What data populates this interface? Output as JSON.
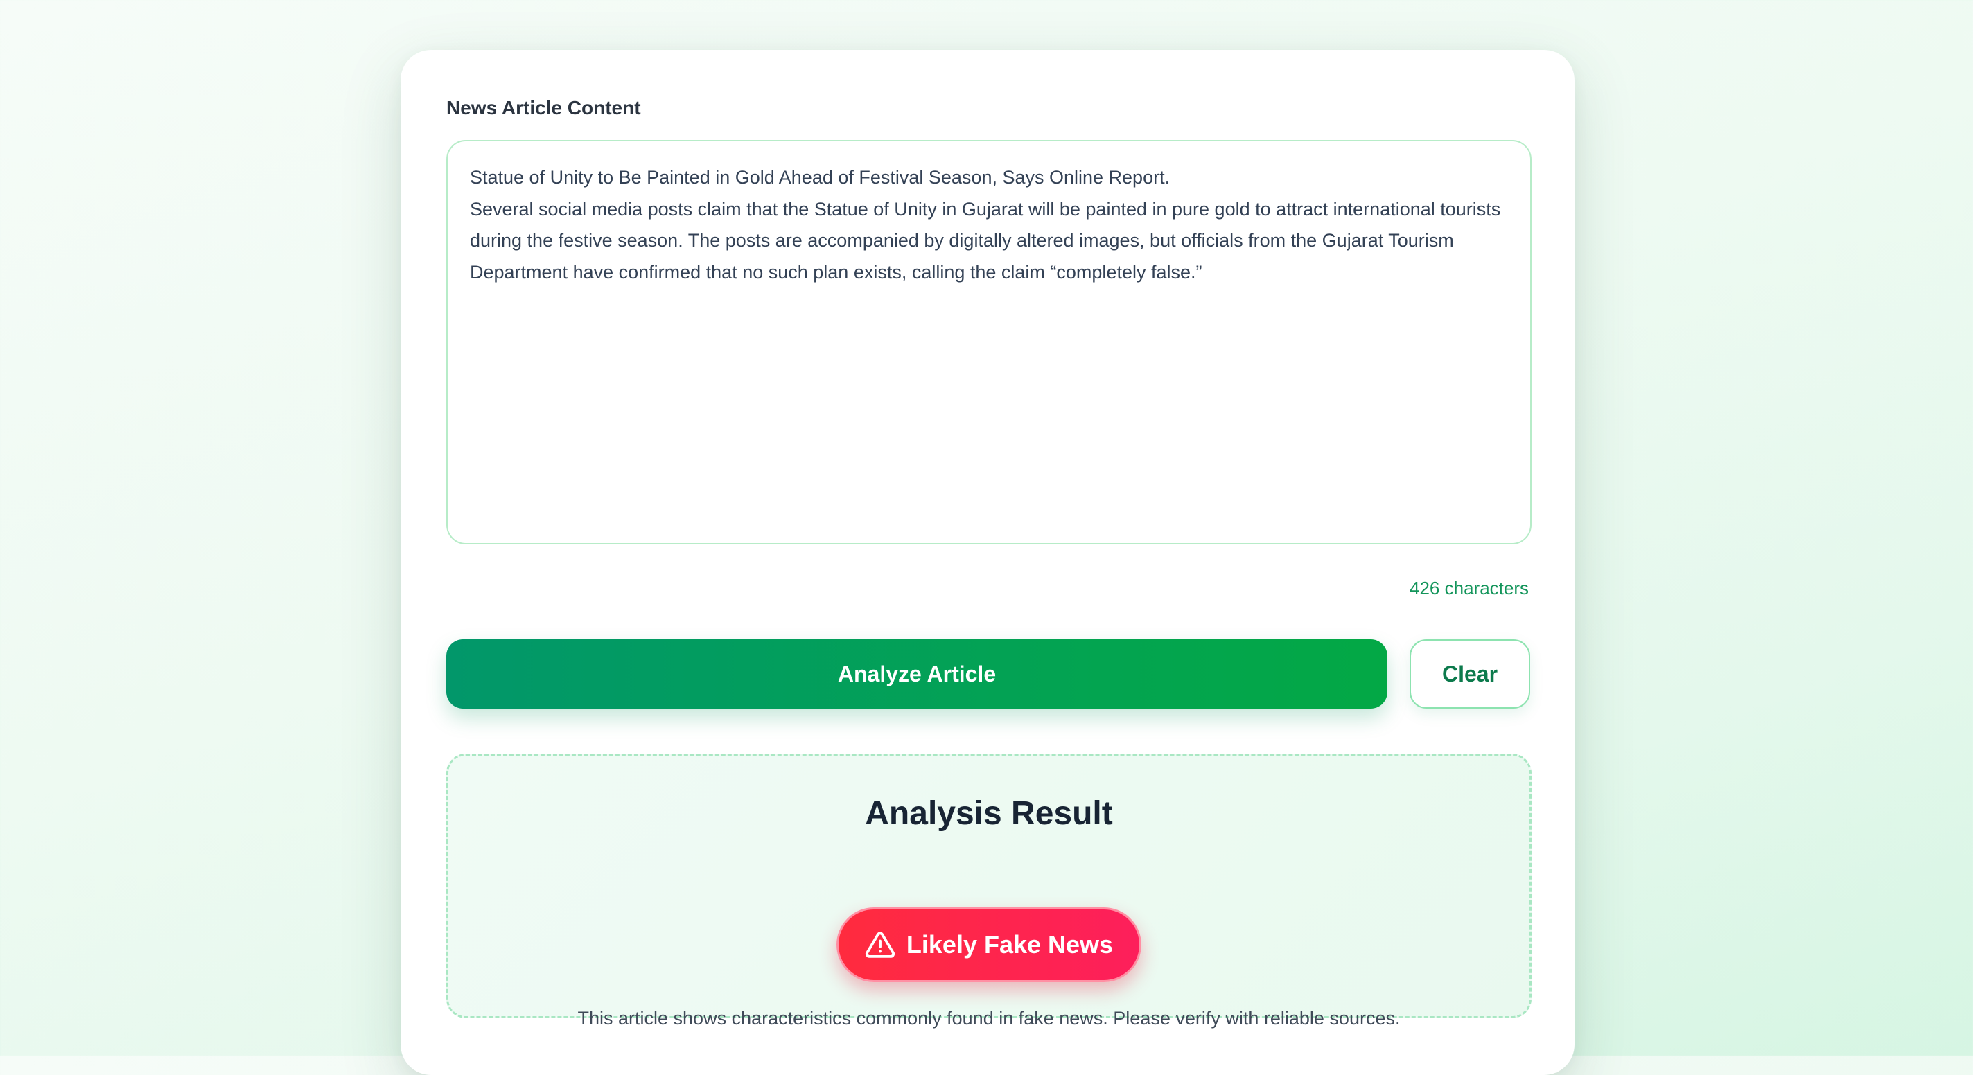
{
  "form": {
    "label": "News Article Content",
    "article_text": "Statue of Unity to Be Painted in Gold Ahead of Festival Season, Says Online Report.\nSeveral social media posts claim that the Statue of Unity in Gujarat will be painted in pure gold to attract international tourists during the festive season. The posts are accompanied by digitally altered images, but officials from the Gujarat Tourism Department have confirmed that no such plan exists, calling the claim “completely false.”",
    "char_count": "426 characters"
  },
  "actions": {
    "analyze_label": "Analyze Article",
    "clear_label": "Clear"
  },
  "result": {
    "title": "Analysis Result",
    "verdict": "Likely Fake News",
    "verdict_icon": "warning-triangle-icon",
    "description": "This article shows characteristics commonly found in fake news. Please verify with reliable sources."
  },
  "colors": {
    "accent_green": "#02976a",
    "accent_green_end": "#03a845",
    "fake_red": "#ff2b3e",
    "fake_pink": "#fd1f5b",
    "count_green": "#14955b"
  }
}
